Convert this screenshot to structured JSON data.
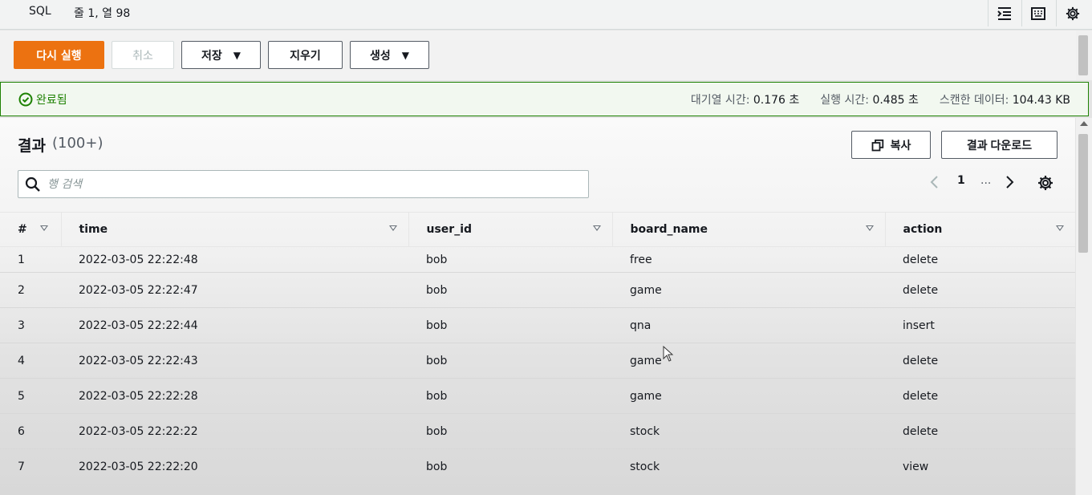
{
  "statusbar": {
    "language": "SQL",
    "position": "줄 1, 열 98",
    "tools": [
      "indent-icon",
      "keyboard-icon",
      "gear-icon"
    ]
  },
  "toolbar": {
    "run_again": "다시 실행",
    "cancel": "취소",
    "save": "저장",
    "clear": "지우기",
    "create": "생성"
  },
  "banner": {
    "status": "완료됨",
    "queue_label": "대기열 시간:",
    "queue_value": "0.176 초",
    "run_label": "실행 시간:",
    "run_value": "0.485 초",
    "scan_label": "스캔한 데이터:",
    "scan_value": "104.43 KB"
  },
  "results": {
    "title": "결과",
    "count": "(100+)",
    "copy": "복사",
    "download": "결과 다운로드",
    "search_placeholder": "행 검색",
    "page": "1",
    "ellipsis": "..."
  },
  "table": {
    "columns": [
      "#",
      "time",
      "user_id",
      "board_name",
      "action"
    ],
    "rows": [
      [
        "1",
        "2022-03-05 22:22:48",
        "bob",
        "free",
        "delete"
      ],
      [
        "2",
        "2022-03-05 22:22:47",
        "bob",
        "game",
        "delete"
      ],
      [
        "3",
        "2022-03-05 22:22:44",
        "bob",
        "qna",
        "insert"
      ],
      [
        "4",
        "2022-03-05 22:22:43",
        "bob",
        "game",
        "delete"
      ],
      [
        "5",
        "2022-03-05 22:22:28",
        "bob",
        "game",
        "delete"
      ],
      [
        "6",
        "2022-03-05 22:22:22",
        "bob",
        "stock",
        "delete"
      ],
      [
        "7",
        "2022-03-05 22:22:20",
        "bob",
        "stock",
        "view"
      ]
    ]
  },
  "colors": {
    "primary": "#ec7211",
    "success": "#1d8102",
    "success_bg": "#f2f8f0"
  }
}
